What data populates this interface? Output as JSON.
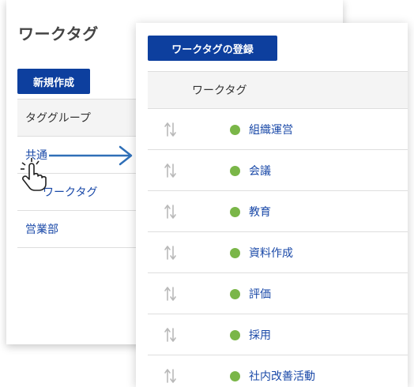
{
  "back_panel": {
    "title": "ワークタグ",
    "new_button_label": "新規作成",
    "group_header_label": "タググループ",
    "groups": [
      {
        "label": "共通"
      },
      {
        "label": "ワークタグ",
        "visible_text": "ワークタグ"
      },
      {
        "label": "営業部"
      }
    ]
  },
  "front_panel": {
    "register_button_label": "ワークタグの登録",
    "column_header_label": "ワークタグ",
    "tag_color": "#7ab648",
    "tags": [
      {
        "label": "組織運営"
      },
      {
        "label": "会議"
      },
      {
        "label": "教育"
      },
      {
        "label": "資料作成"
      },
      {
        "label": "評価"
      },
      {
        "label": "採用"
      },
      {
        "label": "社内改善活動"
      }
    ]
  },
  "colors": {
    "primary_button": "#0d3f9e",
    "link_text": "#1a49a8",
    "arrow": "#2f6fb7"
  },
  "icons": {
    "sort_handle": "sort-handle-icon",
    "pointer": "hand-pointer-icon",
    "arrow": "arrow-right-icon"
  }
}
